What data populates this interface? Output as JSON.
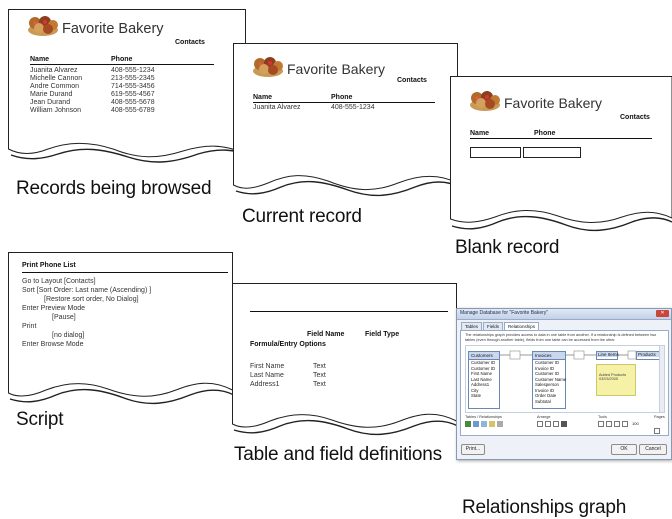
{
  "bakery": {
    "name": "Favorite Bakery",
    "section_title": "Contacts"
  },
  "columns": {
    "name": "Name",
    "phone": "Phone"
  },
  "browse": {
    "caption": "Records being browsed",
    "records": [
      {
        "name": "Juanita Alvarez",
        "phone": "408-555-1234"
      },
      {
        "name": "Michelle Cannon",
        "phone": "213-555-2345"
      },
      {
        "name": "Andre Common",
        "phone": "714-555-3456"
      },
      {
        "name": "Marie Durand",
        "phone": "619-555-4567"
      },
      {
        "name": "Jean Durand",
        "phone": "408-555-5678"
      },
      {
        "name": "William Johnson",
        "phone": "408-555-6789"
      }
    ]
  },
  "current": {
    "caption": "Current record",
    "record": {
      "name": "Juanita Alvarez",
      "phone": "408-555-1234"
    }
  },
  "blank": {
    "caption": "Blank record"
  },
  "script": {
    "caption": "Script",
    "title": "Print Phone List",
    "steps": [
      "Go to Layout [Contacts]",
      "Sort [Sort Order: Last name (Ascending) ]",
      "[Restore sort order, No Dialog]",
      "Enter Preview Mode",
      "[Pause]",
      "Print",
      "[no dialog]",
      "Enter Browse Mode"
    ]
  },
  "definitions": {
    "caption": "Table and field definitions",
    "headers": {
      "field_name": "Field Name",
      "field_type": "Field Type",
      "options": "Formula/Entry Options"
    },
    "fields": [
      {
        "name": "First Name",
        "type": "Text"
      },
      {
        "name": "Last Name",
        "type": "Text"
      },
      {
        "name": "Address1",
        "type": "Text"
      }
    ]
  },
  "relationships": {
    "caption": "Relationships graph",
    "window_title": "Manage Database for \"Favorite Bakery\"",
    "tabs": [
      "Tables",
      "Fields",
      "Relationships"
    ],
    "description": "The relationships graph provides access to data in one table from another. If a relationship is defined between two tables (even through another table), fields from one table can be accessed from the other.",
    "tables": [
      {
        "title": "Customers",
        "fields": [
          "Customer ID",
          "Customer ID",
          "First Name",
          "Last Name",
          "Address1",
          "City",
          "State"
        ]
      },
      {
        "title": "Invoices",
        "fields": [
          "Customer ID",
          "Invoice ID",
          "Customer ID",
          "Customer Name",
          "Salesperson",
          "Invoice ID",
          "Order Date",
          "Subtotal"
        ]
      },
      {
        "title": "Line Items",
        "fields": []
      },
      {
        "title": "Products",
        "fields": []
      }
    ],
    "note": "Added Products 03/03/2005",
    "bottom_labels": {
      "tables": "Tables / Relationships",
      "arrange": "Arrange",
      "tools": "Tools",
      "pages": "Pages"
    },
    "zoom": "100",
    "buttons": {
      "print": "Print...",
      "ok": "OK",
      "cancel": "Cancel"
    }
  }
}
